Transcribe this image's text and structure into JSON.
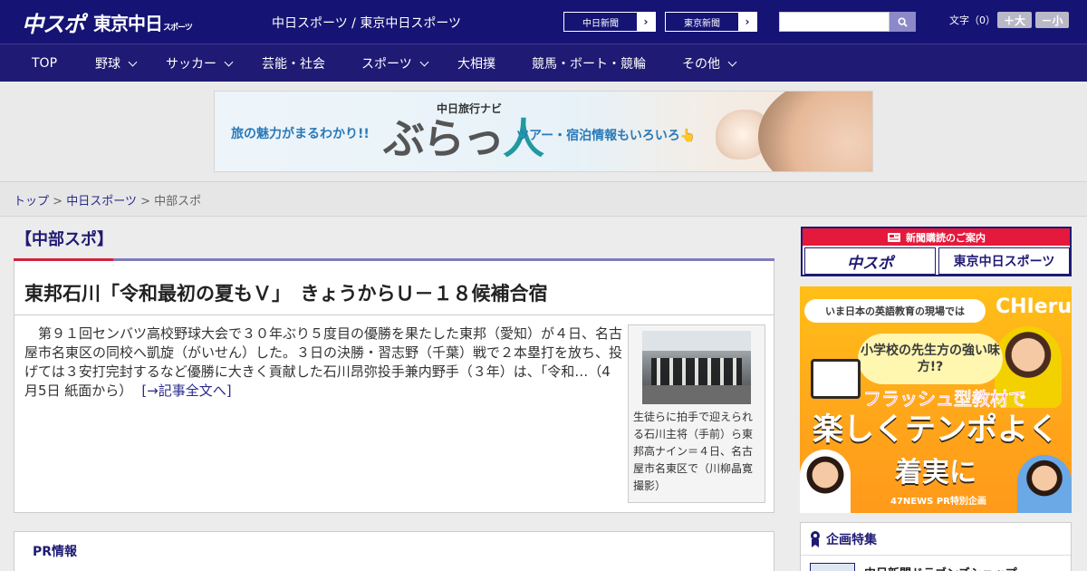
{
  "header": {
    "logo_main": "中スポ",
    "logo_sub": "東京中日",
    "logo_sub_small": "スポーツ",
    "site_title": "中日スポーツ / 東京中日スポーツ",
    "paper_links": [
      {
        "label": "中日新聞",
        "arrow": "›"
      },
      {
        "label": "東京新聞",
        "arrow": "›"
      }
    ],
    "search_placeholder": "",
    "font_size_label": "文字（0）",
    "font_larger": "＋大",
    "font_smaller": "－小"
  },
  "nav": {
    "items": [
      {
        "label": "TOP",
        "dropdown": false
      },
      {
        "label": "野球",
        "dropdown": true
      },
      {
        "label": "サッカー",
        "dropdown": true
      },
      {
        "label": "芸能・社会",
        "dropdown": false
      },
      {
        "label": "スポーツ",
        "dropdown": true
      },
      {
        "label": "大相撲",
        "dropdown": false
      },
      {
        "label": "競馬・ボート・競輪",
        "dropdown": false
      },
      {
        "label": "その他",
        "dropdown": true
      }
    ]
  },
  "banner": {
    "left_text": "旅の魅力がまるわかり!!",
    "brand_small": "中日旅行ナビ",
    "brand_logo_1": "ぶらっ",
    "brand_logo_2": "人",
    "right_text": "ツアー・宿泊情報もいろいろ👆"
  },
  "breadcrumb": {
    "items": [
      {
        "label": "トップ",
        "link": true
      },
      {
        "label": "中日スポーツ",
        "link": true
      },
      {
        "label": "中部スポ",
        "link": false
      }
    ],
    "separator": ">"
  },
  "section": {
    "title": "【中部スポ】"
  },
  "article": {
    "headline": "東邦石川「令和最初の夏もＶ」　きょうからＵ－１８候補合宿",
    "body": "　第９１回センバツ高校野球大会で３０年ぶり５度目の優勝を果たした東邦（愛知）が４日、名古屋市名東区の同校へ凱旋（がいせん）した。３日の決勝・習志野（千葉）戦で２本塁打を放ち、投げては３安打完封するなど優勝に大きく貢献した石川昂弥投手兼内野手（３年）は、「令和…（4月5日 紙面から）",
    "more_link": "[→記事全文へ]",
    "photo_caption": "生徒らに拍手で迎えられる石川主将（手前）ら東邦高ナイン＝４日、名古屋市名東区で（川柳晶寛撮影）"
  },
  "pr": {
    "title": "PR情報",
    "text": ""
  },
  "sidebar": {
    "subscribe_head": "新聞購読のご案内",
    "subscribe_buttons": [
      "中スポ",
      "東京中日スポーツ"
    ],
    "ad": {
      "top_pill": "いま日本の英語教育の現場では",
      "brand": "CHIeru",
      "bubble": "小学校の先生方の強い味方!?",
      "line1": "フラッシュ型教材で",
      "big1": "楽しくテンポよく",
      "big2": "着実に",
      "footer": "47NEWS PR特別企画"
    },
    "plan_title": "企画特集",
    "plan_item": "中日新聞ドラゴンズショップ"
  },
  "colors": {
    "header_bg": "#151475",
    "nav_bg": "#1f1a73",
    "accent_red": "#d4223a",
    "accent_purple": "#7e7cb8",
    "link": "#2a2a8c"
  }
}
